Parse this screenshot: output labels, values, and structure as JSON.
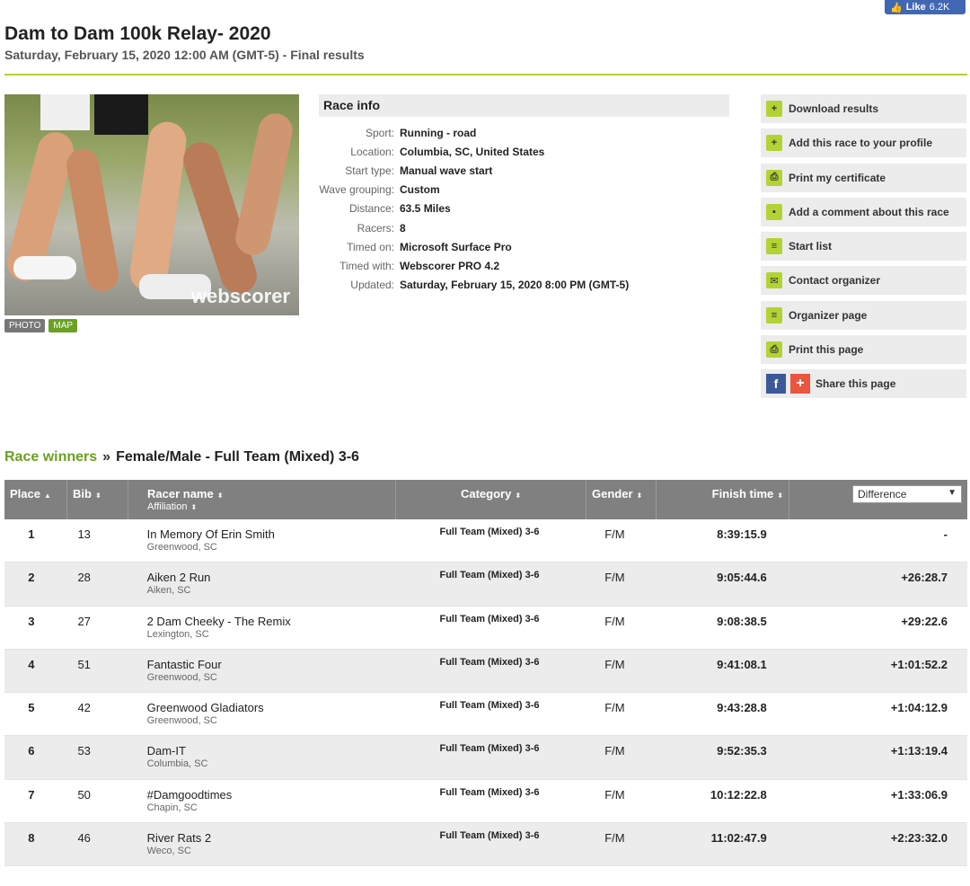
{
  "fb_like": {
    "label": "Like",
    "count": "6.2K"
  },
  "header": {
    "title": "Dam to Dam 100k Relay- 2020",
    "subtitle": "Saturday, February 15, 2020 12:00 AM (GMT-5) - Final results"
  },
  "photo": {
    "watermark": "webscorer",
    "tabs": {
      "photo": "PHOTO",
      "map": "MAP"
    }
  },
  "race_info": {
    "heading": "Race info",
    "rows": [
      {
        "key": "Sport:",
        "value": "Running - road"
      },
      {
        "key": "Location:",
        "value": "Columbia, SC, United States"
      },
      {
        "key": "Start type:",
        "value": "Manual wave start"
      },
      {
        "key": "Wave grouping:",
        "value": "Custom"
      },
      {
        "key": "Distance:",
        "value": "63.5 Miles"
      },
      {
        "key": "Racers:",
        "value": "8"
      },
      {
        "key": "Timed on:",
        "value": "Microsoft Surface Pro"
      },
      {
        "key": "Timed with:",
        "value": "Webscorer PRO 4.2"
      },
      {
        "key": "Updated:",
        "value": "Saturday, February 15, 2020 8:00 PM (GMT-5)"
      }
    ]
  },
  "actions": {
    "download": "Download results",
    "add_race": "Add this race to your profile",
    "certificate": "Print my certificate",
    "comment": "Add a comment about this race",
    "start_list": "Start list",
    "contact": "Contact organizer",
    "organizer_page": "Organizer page",
    "print_page": "Print this page",
    "share": "Share this page"
  },
  "winners": {
    "link": "Race winners",
    "separator": "»",
    "category": "Female/Male - Full Team (Mixed) 3-6"
  },
  "table": {
    "headers": {
      "place": "Place",
      "bib": "Bib",
      "name": "Racer name",
      "affiliation": "Affiliation",
      "category": "Category",
      "gender": "Gender",
      "finish": "Finish time",
      "diff_select": "Difference"
    },
    "rows": [
      {
        "place": "1",
        "bib": "13",
        "name": "In Memory Of Erin Smith",
        "aff": "Greenwood, SC",
        "cat": "Full Team (Mixed) 3-6",
        "gender": "F/M",
        "time": "8:39:15.9",
        "diff": "-"
      },
      {
        "place": "2",
        "bib": "28",
        "name": "Aiken 2 Run",
        "aff": "Aiken, SC",
        "cat": "Full Team (Mixed) 3-6",
        "gender": "F/M",
        "time": "9:05:44.6",
        "diff": "+26:28.7"
      },
      {
        "place": "3",
        "bib": "27",
        "name": "2 Dam Cheeky - The Remix",
        "aff": "Lexington, SC",
        "cat": "Full Team (Mixed) 3-6",
        "gender": "F/M",
        "time": "9:08:38.5",
        "diff": "+29:22.6"
      },
      {
        "place": "4",
        "bib": "51",
        "name": "Fantastic Four",
        "aff": "Greenwood, SC",
        "cat": "Full Team (Mixed) 3-6",
        "gender": "F/M",
        "time": "9:41:08.1",
        "diff": "+1:01:52.2"
      },
      {
        "place": "5",
        "bib": "42",
        "name": "Greenwood Gladiators",
        "aff": "Greenwood, SC",
        "cat": "Full Team (Mixed) 3-6",
        "gender": "F/M",
        "time": "9:43:28.8",
        "diff": "+1:04:12.9"
      },
      {
        "place": "6",
        "bib": "53",
        "name": "Dam-IT",
        "aff": "Columbia, SC",
        "cat": "Full Team (Mixed) 3-6",
        "gender": "F/M",
        "time": "9:52:35.3",
        "diff": "+1:13:19.4"
      },
      {
        "place": "7",
        "bib": "50",
        "name": "#Damgoodtimes",
        "aff": "Chapin, SC",
        "cat": "Full Team (Mixed) 3-6",
        "gender": "F/M",
        "time": "10:12:22.8",
        "diff": "+1:33:06.9"
      },
      {
        "place": "8",
        "bib": "46",
        "name": "River Rats 2",
        "aff": "Weco, SC",
        "cat": "Full Team (Mixed) 3-6",
        "gender": "F/M",
        "time": "11:02:47.9",
        "diff": "+2:23:32.0"
      }
    ]
  },
  "colors": {
    "accent_green": "#b3d335",
    "link_green": "#6aa121",
    "header_gray": "#808080",
    "row_alt": "#ececec"
  }
}
